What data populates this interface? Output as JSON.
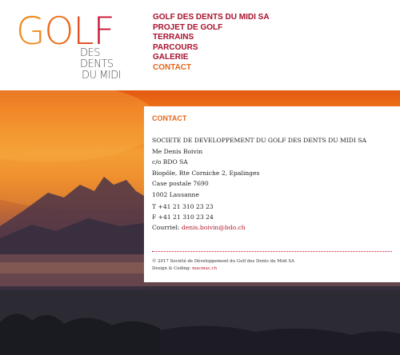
{
  "logo": {
    "golf": [
      "G",
      "O",
      "L",
      "F"
    ],
    "subtitle_line1": "DES DENTS",
    "subtitle_line2": "DU MIDI"
  },
  "nav": {
    "items": [
      {
        "label": "GOLF DES DENTS DU MIDI SA",
        "active": false
      },
      {
        "label": "PROJET DE GOLF",
        "active": false
      },
      {
        "label": "TERRAINS",
        "active": false
      },
      {
        "label": "PARCOURS",
        "active": false
      },
      {
        "label": "GALERIE",
        "active": false
      },
      {
        "label": "CONTACT",
        "active": true
      }
    ]
  },
  "content": {
    "title": "CONTACT",
    "address_lines": [
      "SOCIETE DE DEVELOPPEMENT DU GOLF DES DENTS DU MIDI SA",
      "Me Denis Boivin",
      "c/o BDO SA",
      "Biopôle, Rte Corniche 2, Epalinges",
      "Case postale 7690",
      "1002 Lausanne"
    ],
    "phone": "T +41 21 310 23 23",
    "fax": "F +41 21 310 23 24",
    "email_label": "Courriel: ",
    "email": "denis.boivin@bdo.ch"
  },
  "footer": {
    "copyright": "© 2017 Société de Développement du Golf des Dents du Midi SA",
    "credit_label": "Design & Coding: ",
    "credit_link": "macmac.ch"
  },
  "colors": {
    "brand_red": "#a8102c",
    "accent_orange": "#e2661c"
  }
}
